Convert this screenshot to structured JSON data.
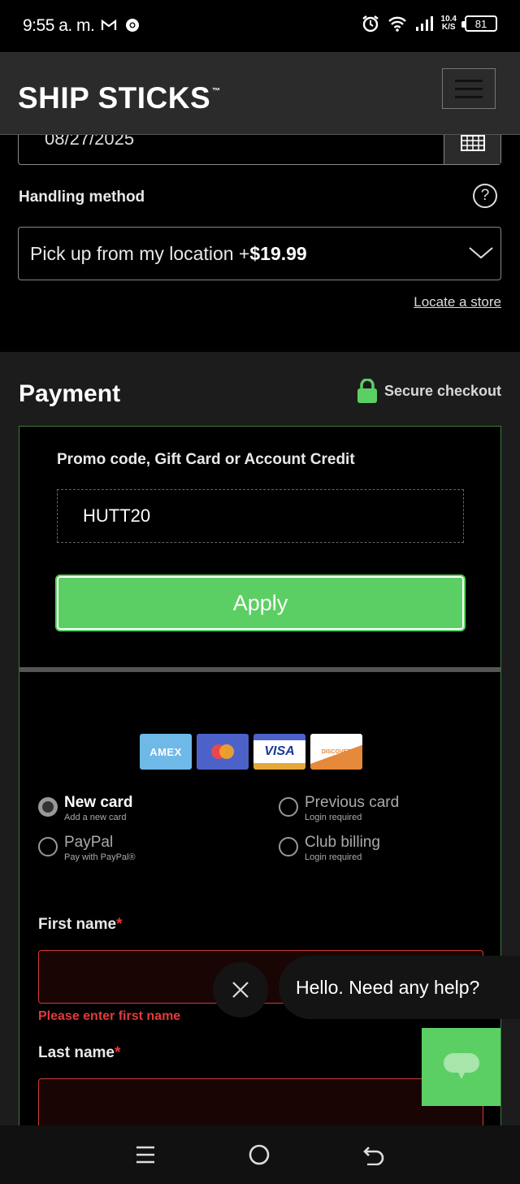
{
  "status_bar": {
    "time": "9:55 a. m.",
    "net_speed_value": "10.4",
    "net_speed_unit": "K/S",
    "battery": "81",
    "icons": [
      "gmail-icon",
      "chrome-icon",
      "alarm-icon",
      "wifi-icon",
      "signal-icon",
      "battery-icon"
    ]
  },
  "header": {
    "logo_text": "SHIP STICKS",
    "logo_tm": "™"
  },
  "delivery": {
    "date_value": "08/27/2025",
    "handling_label": "Handling method",
    "handling_value_prefix": "Pick up from my location +",
    "handling_value_price": "$19.99",
    "locate_link": "Locate a store"
  },
  "payment": {
    "title": "Payment",
    "secure_label": "Secure checkout",
    "promo_label": "Promo code, Gift Card or Account Credit",
    "promo_value": "HUTT20",
    "apply_label": "Apply",
    "card_brands": [
      "AMEX",
      "Mastercard",
      "VISA",
      "DISCOVER"
    ],
    "options": [
      {
        "title": "New card",
        "sub": "Add a new card",
        "selected": true
      },
      {
        "title": "Previous card",
        "sub": "Login required",
        "selected": false
      },
      {
        "title": "PayPal",
        "sub": "Pay with PayPal®",
        "selected": false
      },
      {
        "title": "Club billing",
        "sub": "Login required",
        "selected": false
      }
    ],
    "first_name_label": "First name",
    "first_name_error": "Please enter first name",
    "last_name_label": "Last name",
    "required_mark": "*"
  },
  "chat": {
    "greeting": "Hello. Need any help?"
  },
  "colors": {
    "accent_green": "#5bcf63",
    "error_red": "#e23b3b",
    "header_bg": "#2b2b2b"
  }
}
